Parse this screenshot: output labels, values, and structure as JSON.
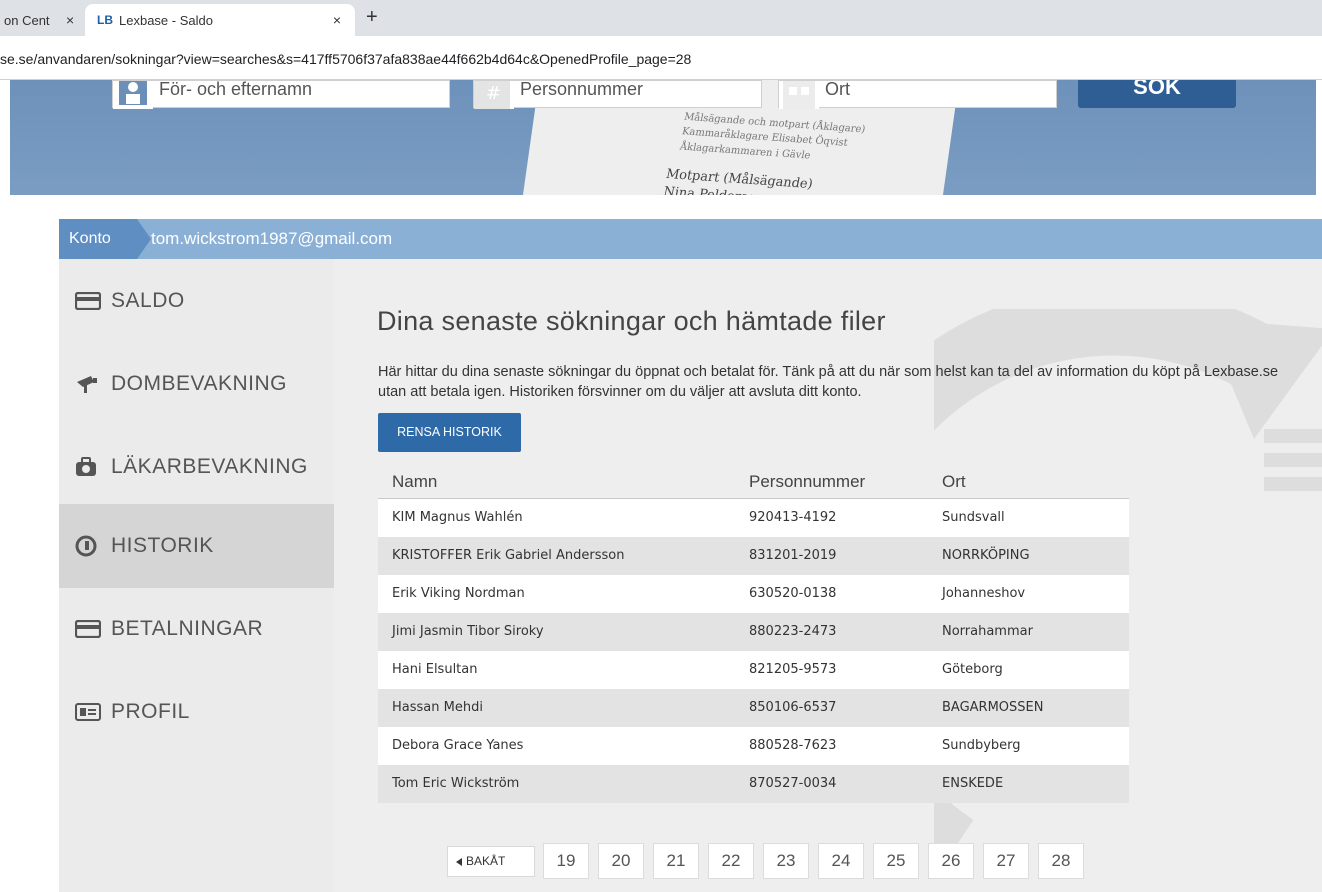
{
  "browser": {
    "tabs": [
      {
        "label": "on Cent",
        "active": false
      },
      {
        "logo": "LB",
        "label": "Lexbase - Saldo",
        "active": true
      }
    ],
    "new_tab": "+",
    "close": "×",
    "url": "se.se/anvandaren/sokningar?view=searches&s=417ff5706f37afa838ae44f662b4d64c&OpenedProfile_page=28"
  },
  "search": {
    "name_placeholder": "För- och efternamn",
    "pnr_placeholder": "Personnummer",
    "city_placeholder": "Ort",
    "button": "SÖK",
    "paper_lines": [
      "Målsägande och motpart (Åklagare)",
      "Kammaråklagare Elisabet Öqvist",
      "Åklagarkammaren i Gävle",
      "Motpart (Målsägande)",
      "Nina Peldersen"
    ]
  },
  "account": {
    "label": "Konto",
    "email": "tom.wickstrom1987@gmail.com"
  },
  "sidebar": {
    "items": [
      {
        "label": "SALDO",
        "icon": "card-icon"
      },
      {
        "label": "DOMBEVAKNING",
        "icon": "camera-icon"
      },
      {
        "label": "LÄKARBEVAKNING",
        "icon": "bag-icon"
      },
      {
        "label": "HISTORIK",
        "icon": "history-icon",
        "active": true
      },
      {
        "label": "BETALNINGAR",
        "icon": "card-icon"
      },
      {
        "label": "PROFIL",
        "icon": "id-card-icon"
      }
    ]
  },
  "main": {
    "heading": "Dina senaste sökningar och hämtade filer",
    "description": "Här hittar du dina senaste sökningar du öppnat och betalat för. Tänk på att du när som helst kan ta del av information du köpt på Lexbase.se utan att betala igen. Historiken försvinner om du väljer att avsluta ditt konto.",
    "clear_button": "RENSA HISTORIK",
    "table": {
      "headers": [
        "Namn",
        "Personnummer",
        "Ort"
      ],
      "rows": [
        [
          "KIM Magnus Wahlén",
          "920413-4192",
          "Sundsvall"
        ],
        [
          "KRISTOFFER Erik Gabriel Andersson",
          "831201-2019",
          "NORRKÖPING"
        ],
        [
          "Erik Viking Nordman",
          "630520-0138",
          "Johanneshov"
        ],
        [
          "Jimi Jasmin Tibor Siroky",
          "880223-2473",
          "Norrahammar"
        ],
        [
          "Hani Elsultan",
          "821205-9573",
          "Göteborg"
        ],
        [
          "Hassan Mehdi",
          "850106-6537",
          "BAGARMOSSEN"
        ],
        [
          "Debora Grace Yanes",
          "880528-7623",
          "Sundbyberg"
        ],
        [
          "Tom Eric Wickström",
          "870527-0034",
          "ENSKEDE"
        ]
      ]
    },
    "pagination": {
      "prev": "BAKÅT",
      "pages": [
        "19",
        "20",
        "21",
        "22",
        "23",
        "24",
        "25",
        "26",
        "27",
        "28"
      ]
    }
  }
}
